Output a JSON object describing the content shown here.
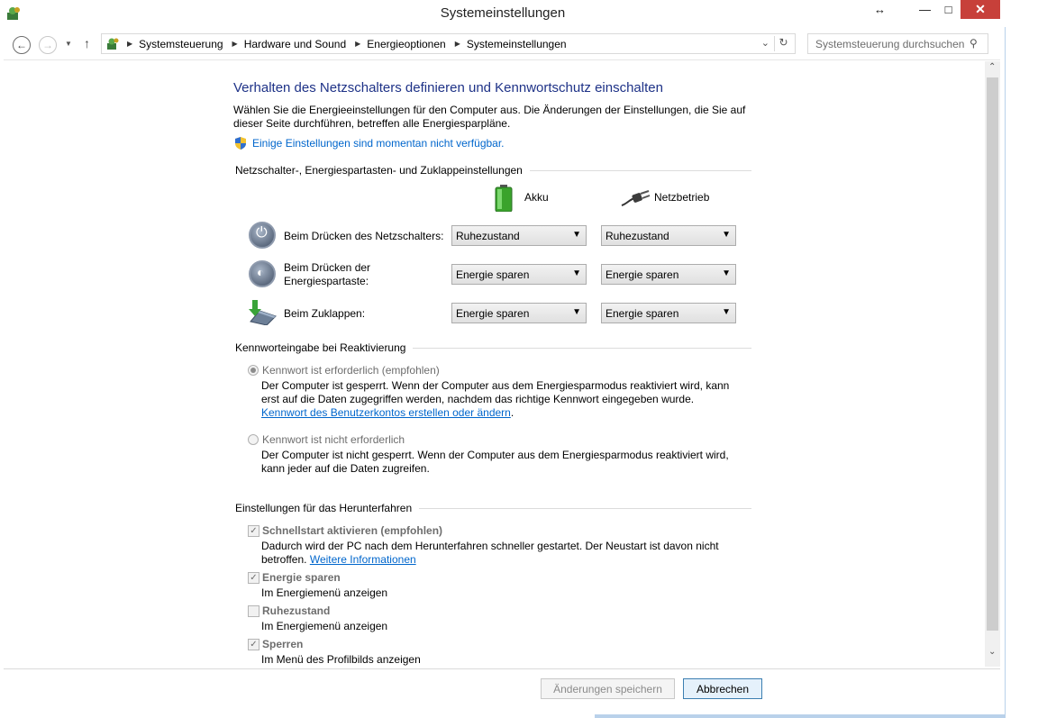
{
  "window": {
    "title": "Systemeinstellungen",
    "controls": {
      "resize": "↔",
      "minimize": "—",
      "maximize": "□",
      "close": "✕"
    }
  },
  "address": {
    "crumbs": [
      "Systemsteuerung",
      "Hardware und Sound",
      "Energieoptionen",
      "Systemeinstellungen"
    ],
    "search_placeholder": "Systemsteuerung durchsuchen"
  },
  "main": {
    "heading": "Verhalten des Netzschalters definieren und Kennwortschutz einschalten",
    "intro_line1": "Wählen Sie die Energieeinstellungen für den Computer aus. Die Änderungen der Einstellungen, die Sie auf",
    "intro_line2": "dieser Seite durchführen, betreffen alle Energiesparpläne.",
    "unavailable_link": "Einige Einstellungen sind momentan nicht verfügbar.",
    "buttons_section": {
      "title": "Netzschalter-, Energiespartasten- und Zuklappeinstellungen",
      "col_battery": "Akku",
      "col_power": "Netzbetrieb",
      "rows": [
        {
          "label1": "Beim Drücken des Netzschalters:",
          "label2": "",
          "battery": "Ruhezustand",
          "power": "Ruhezustand"
        },
        {
          "label1": "Beim Drücken der",
          "label2": "Energiespartaste:",
          "battery": "Energie sparen",
          "power": "Energie sparen"
        },
        {
          "label1": "Beim Zuklappen:",
          "label2": "",
          "battery": "Energie sparen",
          "power": "Energie sparen"
        }
      ]
    },
    "password_section": {
      "title": "Kennworteingabe bei Reaktivierung",
      "opt1_label": "Kennwort ist erforderlich (empfohlen)",
      "opt1_desc1": "Der Computer ist gesperrt. Wenn der Computer aus dem Energiesparmodus reaktiviert wird, kann",
      "opt1_desc2": "erst auf die Daten zugegriffen werden, nachdem das richtige Kennwort eingegeben wurde.",
      "opt1_link": "Kennwort des Benutzerkontos erstellen oder ändern",
      "opt2_label": "Kennwort ist nicht erforderlich",
      "opt2_desc1": "Der Computer ist nicht gesperrt. Wenn der Computer aus dem Energiesparmodus reaktiviert wird,",
      "opt2_desc2": "kann jeder auf die Daten zugreifen."
    },
    "shutdown_section": {
      "title": "Einstellungen für das Herunterfahren",
      "fast_label": "Schnellstart aktivieren (empfohlen)",
      "fast_desc1": "Dadurch wird der PC nach dem Herunterfahren schneller gestartet. Der Neustart ist davon nicht",
      "fast_desc2": "betroffen.",
      "fast_link": "Weitere Informationen",
      "sleep_label": "Energie sparen",
      "sleep_desc": "Im Energiemenü anzeigen",
      "hibernate_label": "Ruhezustand",
      "hibernate_desc": "Im Energiemenü anzeigen",
      "lock_label": "Sperren",
      "lock_desc": "Im Menü des Profilbilds anzeigen"
    }
  },
  "footer": {
    "save_label": "Änderungen speichern",
    "cancel_label": "Abbrechen"
  }
}
